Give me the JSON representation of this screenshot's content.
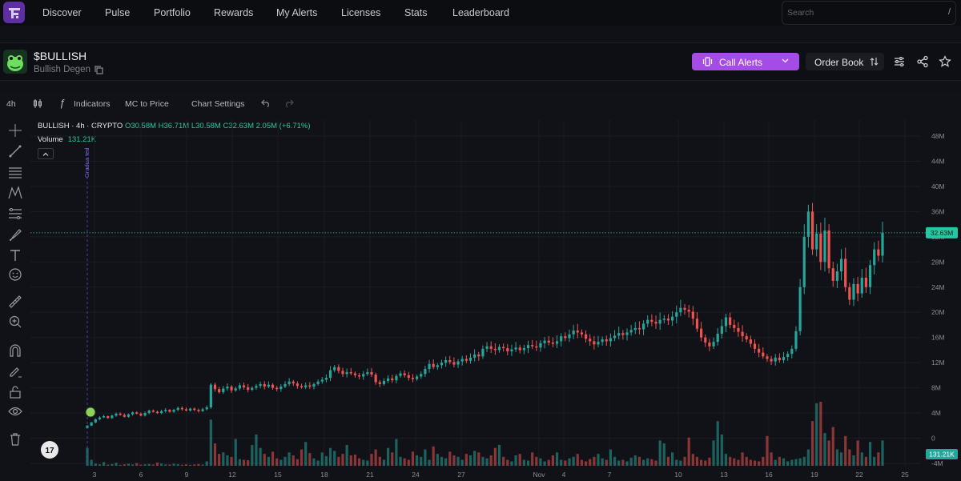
{
  "nav": {
    "items": [
      "Discover",
      "Pulse",
      "Portfolio",
      "Rewards",
      "My Alerts",
      "Licenses",
      "Stats",
      "Leaderboard"
    ],
    "search_placeholder": "Search",
    "search_shortcut": "/"
  },
  "token": {
    "symbol": "$BULLISH",
    "name": "Bullish Degen",
    "call_alerts_label": "Call Alerts",
    "order_book_label": "Order Book"
  },
  "chart_toolbar": {
    "interval": "4h",
    "indicators_label": "Indicators",
    "mc_price_label": "MC to Price",
    "settings_label": "Chart Settings"
  },
  "legend": {
    "series": "BULLISH · 4h · CRYPTO",
    "ohlc": "O30.58M H36.71M L30.58M C32.63M 2.05M (+6.71%)",
    "volume_label": "Volume",
    "volume_value": "131.21K"
  },
  "annotations": {
    "vertical_marker_label": "Gradua ted"
  },
  "colors": {
    "up": "#26a69a",
    "down": "#ef5350",
    "accent": "#a54ce6",
    "price_line": "#26c6a0"
  },
  "chart_data": {
    "type": "candlestick",
    "title": "BULLISH · 4h · CRYPTO",
    "y_axis_ticks": [
      "48M",
      "44M",
      "40M",
      "36M",
      "32M",
      "28M",
      "24M",
      "20M",
      "16M",
      "12M",
      "8M",
      "4M",
      "0",
      "-4M"
    ],
    "ylim": [
      -4,
      48
    ],
    "y_unit": "M",
    "x_axis_ticks": [
      "3",
      "6",
      "9",
      "12",
      "15",
      "18",
      "21",
      "24",
      "27",
      "Nov",
      "4",
      "7",
      "10",
      "13",
      "16",
      "19",
      "22",
      "25"
    ],
    "last_price_label": "32.63M",
    "last_volume_label": "131.21K",
    "close_series": [
      2,
      2.5,
      3,
      3.3,
      3.5,
      3.2,
      3.6,
      3.9,
      3.7,
      3.4,
      3.8,
      4.1,
      3.9,
      3.6,
      4.0,
      4.4,
      4.2,
      4.0,
      4.3,
      4.5,
      4.2,
      4.5,
      4.8,
      4.6,
      4.4,
      4.7,
      4.5,
      4.3,
      4.6,
      4.9,
      8.5,
      7.8,
      7.3,
      7.9,
      8.2,
      7.6,
      7.9,
      8.4,
      8.1,
      7.7,
      8.0,
      8.3,
      8.6,
      8.2,
      8.5,
      8.0,
      7.8,
      8.2,
      8.6,
      9.0,
      8.7,
      8.3,
      8.1,
      8.4,
      8.2,
      8.6,
      9.0,
      9.3,
      9.6,
      10.8,
      11.3,
      10.7,
      10.2,
      10.5,
      10.3,
      10.0,
      9.8,
      10.2,
      10.5,
      10.1,
      8.9,
      8.6,
      9.1,
      9.5,
      9.2,
      9.9,
      10.3,
      10.0,
      9.6,
      9.4,
      9.8,
      10.2,
      11.0,
      11.8,
      11.3,
      11.6,
      12.0,
      12.4,
      12.1,
      11.7,
      12.2,
      12.6,
      12.3,
      12.8,
      13.3,
      13.0,
      14.2,
      14.6,
      14.2,
      14.0,
      14.5,
      14.3,
      13.8,
      14.1,
      14.4,
      14.0,
      14.3,
      14.8,
      14.6,
      14.4,
      15.1,
      15.5,
      15.2,
      15.0,
      15.4,
      16.2,
      15.9,
      16.5,
      17.1,
      16.8,
      16.5,
      15.8,
      15.4,
      14.9,
      15.3,
      15.7,
      15.4,
      15.9,
      16.3,
      16.7,
      16.4,
      16.8,
      17.2,
      17.5,
      17.3,
      18.2,
      18.8,
      18.5,
      18.2,
      18.8,
      19.0,
      18.7,
      19.3,
      20.0,
      20.7,
      20.4,
      20.1,
      19.0,
      17.4,
      16.0,
      15.2,
      14.6,
      15.3,
      16.6,
      17.8,
      19.2,
      18.0,
      17.5,
      16.9,
      16.2,
      15.7,
      15.0,
      14.2,
      13.6,
      13.0,
      12.6,
      12.2,
      12.8,
      12.4,
      12.9,
      13.4,
      14.2,
      17.0,
      24.0,
      32.0,
      36.0,
      30.0,
      32.5,
      28.0,
      33.0,
      27.0,
      25.0,
      26.5,
      28.5,
      24.0,
      22.0,
      24.5,
      23.0,
      25.5,
      24.0,
      27.5,
      30.0,
      29.0,
      32.63
    ],
    "volume_series_K": [
      120,
      40,
      15,
      10,
      25,
      8,
      12,
      20,
      6,
      10,
      14,
      9,
      18,
      7,
      10,
      12,
      8,
      22,
      15,
      9,
      8,
      14,
      11,
      7,
      10,
      6,
      9,
      12,
      8,
      30,
      310,
      150,
      80,
      90,
      70,
      60,
      180,
      45,
      40,
      38,
      140,
      210,
      120,
      80,
      60,
      95,
      50,
      40,
      60,
      90,
      70,
      45,
      110,
      160,
      85,
      50,
      35,
      90,
      65,
      120,
      100,
      60,
      80,
      140,
      70,
      75,
      50,
      40,
      35,
      80,
      110,
      60,
      40,
      120,
      90,
      180,
      60,
      50,
      40,
      95,
      70,
      60,
      110,
      40,
      130,
      80,
      60,
      50,
      95,
      70,
      60,
      40,
      80,
      70,
      100,
      90,
      60,
      50,
      70,
      120,
      140,
      60,
      40,
      30,
      70,
      80,
      40,
      35,
      90,
      60,
      50,
      30,
      40,
      70,
      90,
      40,
      35,
      50,
      60,
      80,
      40,
      30,
      45,
      60,
      80,
      50,
      40,
      110,
      60,
      35,
      40,
      30,
      55,
      70,
      60,
      40,
      50,
      45,
      35,
      170,
      150,
      60,
      90,
      40,
      35,
      60,
      190,
      80,
      60,
      40,
      35,
      55,
      170,
      300,
      210,
      80,
      60,
      50,
      40,
      90,
      60,
      40,
      35,
      30,
      60,
      200,
      90,
      40,
      60,
      50,
      30,
      40,
      45,
      50,
      60,
      110,
      300,
      420,
      430,
      220,
      170,
      260,
      110,
      90,
      200,
      110,
      70,
      170,
      90,
      60,
      160,
      60,
      90,
      170,
      131.21
    ]
  }
}
